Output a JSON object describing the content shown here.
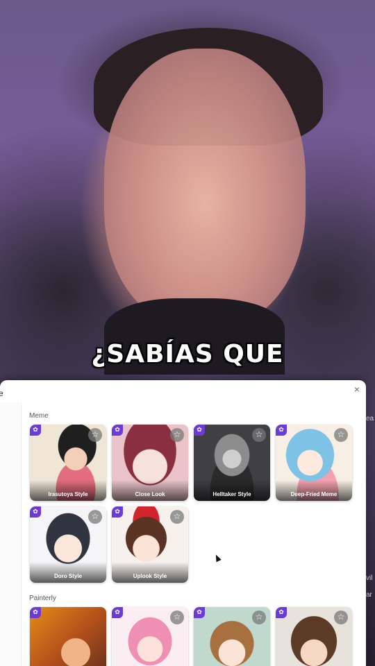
{
  "subtitle": "¿SABÍAS QUE",
  "panel": {
    "title": "e",
    "close_icon": "×"
  },
  "sections": [
    {
      "title": "Meme",
      "cards": [
        {
          "label": "Irasutoya Style",
          "badge_icon": "flower-icon",
          "star_icon": "star-icon"
        },
        {
          "label": "Close Look",
          "badge_icon": "flower-icon",
          "star_icon": "star-icon"
        },
        {
          "label": "Helltaker Style",
          "badge_icon": "flower-icon",
          "star_icon": "star-icon"
        },
        {
          "label": "Deep-Fried Meme",
          "badge_icon": "flower-icon",
          "star_icon": "star-icon"
        },
        {
          "label": "Doro Style",
          "badge_icon": "flower-icon",
          "star_icon": "star-icon"
        },
        {
          "label": "Uplook Style",
          "badge_icon": "flower-icon",
          "star_icon": "star-icon"
        }
      ]
    },
    {
      "title": "Painterly",
      "cards": [
        {
          "label": "",
          "badge_icon": "flower-icon",
          "star_icon": "star-icon"
        },
        {
          "label": "",
          "badge_icon": "flower-icon",
          "star_icon": "star-icon"
        },
        {
          "label": "",
          "badge_icon": "flower-icon",
          "star_icon": "star-icon"
        },
        {
          "label": "",
          "badge_icon": "flower-icon",
          "star_icon": "star-icon"
        }
      ]
    }
  ],
  "icons": {
    "badge": "✿",
    "star": "☆"
  },
  "side_text": [
    "ea",
    "vil",
    "ar"
  ]
}
